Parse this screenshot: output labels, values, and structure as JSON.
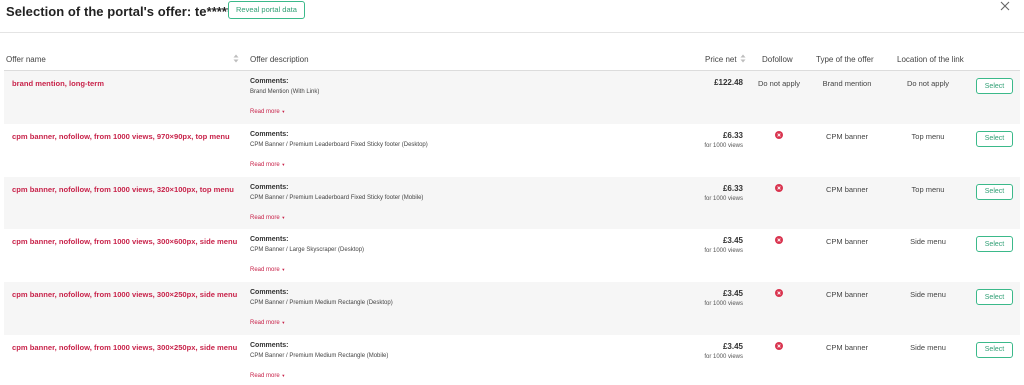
{
  "header": {
    "title": "Selection of the portal's offer: te*********.com",
    "reveal_label": "Reveal portal data"
  },
  "colors": {
    "accent_green": "#3bb98a",
    "offer_red": "#c8234a",
    "no_icon_red": "#d9344f"
  },
  "table": {
    "columns": {
      "offer_name": "Offer name",
      "description": "Offer description",
      "price": "Price net",
      "dofollow": "Dofollow",
      "type": "Type of the offer",
      "location": "Location of the link"
    },
    "rows": [
      {
        "name": "brand mention, long-term",
        "comments_label": "Comments:",
        "comments": "Brand Mention (With Link)",
        "read_more": "Read more",
        "price": "£122.48",
        "price_unit": "",
        "dofollow": "Do not apply",
        "dofollow_icon": "",
        "type": "Brand mention",
        "location": "Do not apply",
        "select": "Select"
      },
      {
        "name": "cpm banner, nofollow, from 1000 views, 970×90px, top menu",
        "comments_label": "Comments:",
        "comments": "CPM Banner / Premium Leaderboard Fixed Sticky footer (Desktop)",
        "read_more": "Read more",
        "price": "£6.33",
        "price_unit": "for 1000 views",
        "dofollow": "",
        "dofollow_icon": "x-circle-icon",
        "type": "CPM banner",
        "location": "Top menu",
        "select": "Select"
      },
      {
        "name": "cpm banner, nofollow, from 1000 views, 320×100px, top menu",
        "comments_label": "Comments:",
        "comments": "CPM Banner / Premium Leaderboard Fixed Sticky footer (Mobile)",
        "read_more": "Read more",
        "price": "£6.33",
        "price_unit": "for 1000 views",
        "dofollow": "",
        "dofollow_icon": "x-circle-icon",
        "type": "CPM banner",
        "location": "Top menu",
        "select": "Select"
      },
      {
        "name": "cpm banner, nofollow, from 1000 views, 300×600px, side menu",
        "comments_label": "Comments:",
        "comments": "CPM Banner / Large Skyscraper (Desktop)",
        "read_more": "Read more",
        "price": "£3.45",
        "price_unit": "for 1000 views",
        "dofollow": "",
        "dofollow_icon": "x-circle-icon",
        "type": "CPM banner",
        "location": "Side menu",
        "select": "Select"
      },
      {
        "name": "cpm banner, nofollow, from 1000 views, 300×250px, side menu",
        "comments_label": "Comments:",
        "comments": "CPM Banner / Premium Medium Rectangle (Desktop)",
        "read_more": "Read more",
        "price": "£3.45",
        "price_unit": "for 1000 views",
        "dofollow": "",
        "dofollow_icon": "x-circle-icon",
        "type": "CPM banner",
        "location": "Side menu",
        "select": "Select"
      },
      {
        "name": "cpm banner, nofollow, from 1000 views, 300×250px, side menu",
        "comments_label": "Comments:",
        "comments": "CPM Banner / Premium Medium Rectangle (Mobile)",
        "read_more": "Read more",
        "price": "£3.45",
        "price_unit": "for 1000 views",
        "dofollow": "",
        "dofollow_icon": "x-circle-icon",
        "type": "CPM banner",
        "location": "Side menu",
        "select": "Select"
      }
    ]
  }
}
